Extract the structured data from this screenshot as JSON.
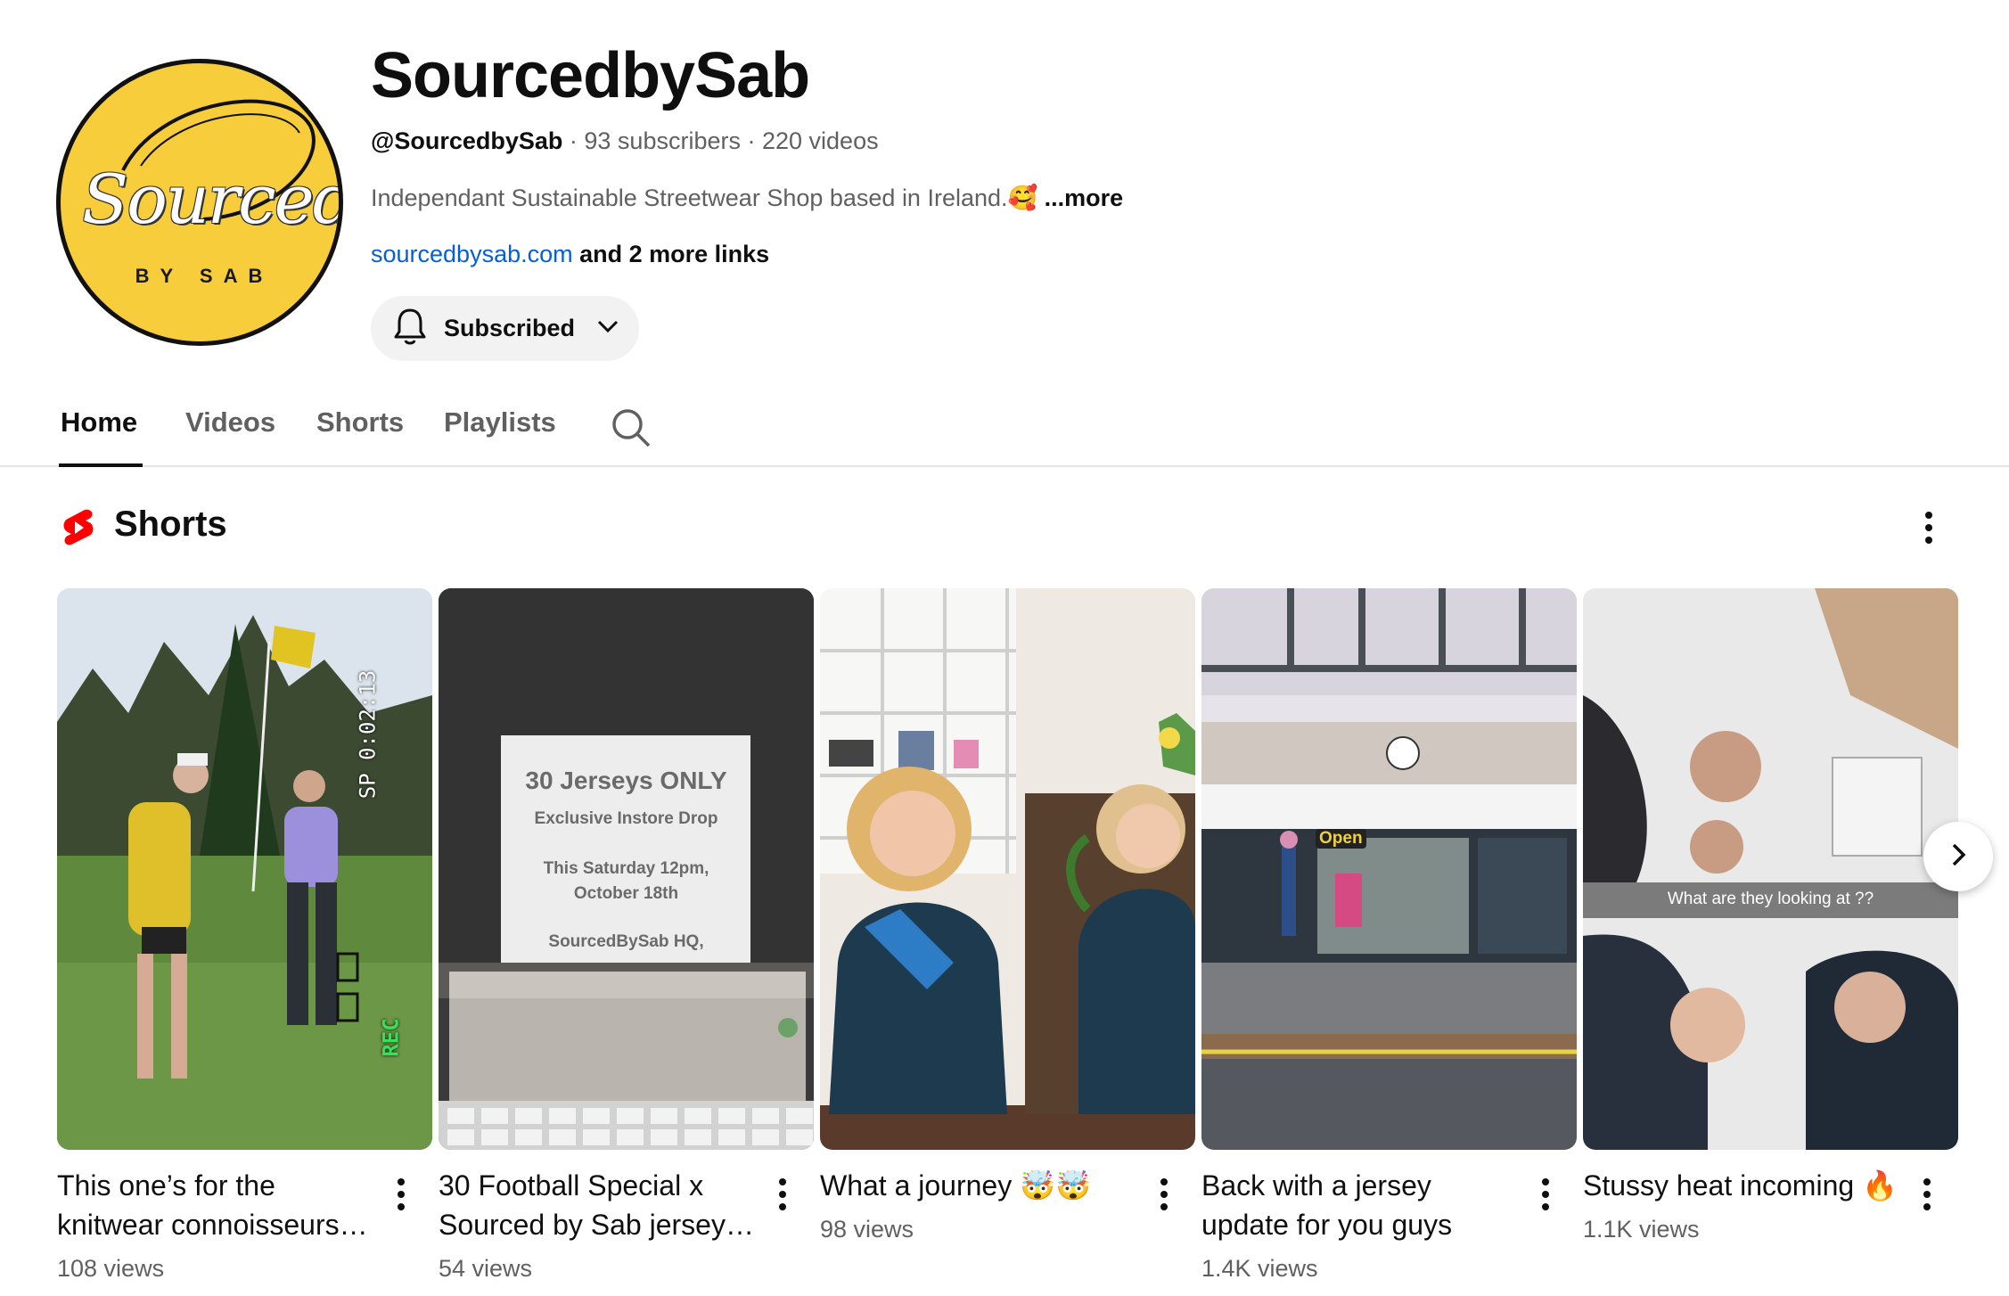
{
  "channel": {
    "avatar_text": "Sourced.",
    "avatar_subtext": "BY SAB",
    "title": "SourcedbySab",
    "handle": "@SourcedbySab",
    "subscribers": "93 subscribers",
    "videos": "220 videos",
    "separator": " · ",
    "description": "Independant Sustainable Streetwear Shop based in Ireland.🥰",
    "more_label": " ...more",
    "link": "sourcedbysab.com",
    "more_links": " and 2 more links",
    "subscribe_label": "Subscribed"
  },
  "tabs": [
    {
      "label": "Home",
      "active": true
    },
    {
      "label": "Videos",
      "active": false
    },
    {
      "label": "Shorts",
      "active": false
    },
    {
      "label": "Playlists",
      "active": false
    }
  ],
  "section": {
    "title": "Shorts"
  },
  "shorts": [
    {
      "title": "This one’s for the knitwear connoisseurs…",
      "views": "108 views",
      "overlay_timer": "0:02:13",
      "overlay_sp": "SP",
      "overlay_rec": "REC"
    },
    {
      "title": "30 Football Special x Sourced by Sab jersey…",
      "views": "54 views",
      "sign_line1": "30 Jerseys ONLY",
      "sign_line2": "Exclusive Instore Drop",
      "sign_line3": "This Saturday 12pm,",
      "sign_line4": "October 18th",
      "sign_line5": "SourcedBySab HQ,"
    },
    {
      "title": "What a journey 🤯🤯",
      "views": "98 views"
    },
    {
      "title": "Back with a jersey update for you guys ❤️…",
      "views": "1.4K views",
      "store_open": "Open"
    },
    {
      "title": "Stussy heat incoming 🔥",
      "views": "1.1K views",
      "caption": "What are they looking at ??"
    }
  ],
  "colors": {
    "accent_red": "#ff0000",
    "link_blue": "#065fd4",
    "muted_text": "#606060",
    "avatar_yellow": "#f8cd3c"
  }
}
